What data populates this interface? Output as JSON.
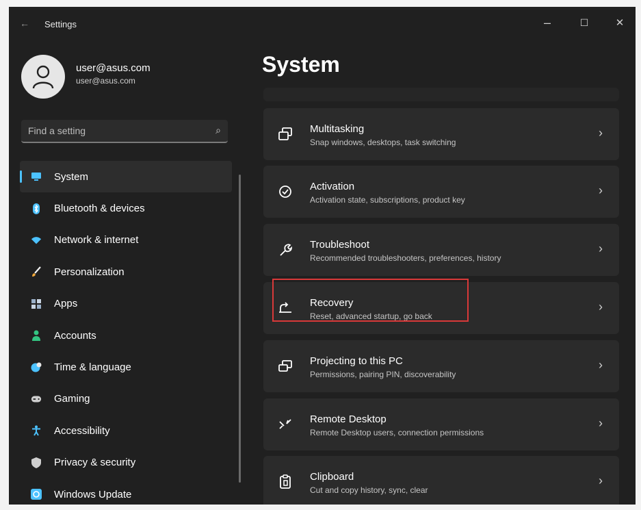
{
  "window": {
    "title": "Settings",
    "minimize_glyph": "–",
    "maximize_glyph": "☐",
    "close_glyph": "✕"
  },
  "profile": {
    "name": "user@asus.com",
    "email": "user@asus.com"
  },
  "search": {
    "placeholder": "Find a setting"
  },
  "sidebar": {
    "items": [
      {
        "label": "System",
        "icon": "monitor-icon",
        "color": "#4cc2ff",
        "selected": true
      },
      {
        "label": "Bluetooth & devices",
        "icon": "bluetooth-icon",
        "color": "#4cc2ff"
      },
      {
        "label": "Network & internet",
        "icon": "wifi-icon",
        "color": "#4cc2ff"
      },
      {
        "label": "Personalization",
        "icon": "brush-icon",
        "color": "#f2a93b"
      },
      {
        "label": "Apps",
        "icon": "apps-icon",
        "color": "#9ab0c8"
      },
      {
        "label": "Accounts",
        "icon": "person-icon",
        "color": "#33c481"
      },
      {
        "label": "Time & language",
        "icon": "globe-clock-icon",
        "color": "#4cc2ff"
      },
      {
        "label": "Gaming",
        "icon": "gamepad-icon",
        "color": "#cfcfcf"
      },
      {
        "label": "Accessibility",
        "icon": "accessibility-icon",
        "color": "#4cc2ff"
      },
      {
        "label": "Privacy & security",
        "icon": "shield-icon",
        "color": "#cfcfcf"
      },
      {
        "label": "Windows Update",
        "icon": "windows-update-icon",
        "color": "#4cc2ff"
      }
    ]
  },
  "main": {
    "title": "System",
    "items": [
      {
        "title": "Multitasking",
        "subtitle": "Snap windows, desktops, task switching",
        "icon": "multitasking-icon"
      },
      {
        "title": "Activation",
        "subtitle": "Activation state, subscriptions, product key",
        "icon": "activation-check-icon"
      },
      {
        "title": "Troubleshoot",
        "subtitle": "Recommended troubleshooters, preferences, history",
        "icon": "wrench-icon"
      },
      {
        "title": "Recovery",
        "subtitle": "Reset, advanced startup, go back",
        "icon": "recovery-icon",
        "highlighted": true
      },
      {
        "title": "Projecting to this PC",
        "subtitle": "Permissions, pairing PIN, discoverability",
        "icon": "projecting-icon"
      },
      {
        "title": "Remote Desktop",
        "subtitle": "Remote Desktop users, connection permissions",
        "icon": "remote-desktop-icon"
      },
      {
        "title": "Clipboard",
        "subtitle": "Cut and copy history, sync, clear",
        "icon": "clipboard-icon"
      }
    ]
  },
  "colors": {
    "accent": "#4cc2ff",
    "highlight_border": "#d93939"
  }
}
